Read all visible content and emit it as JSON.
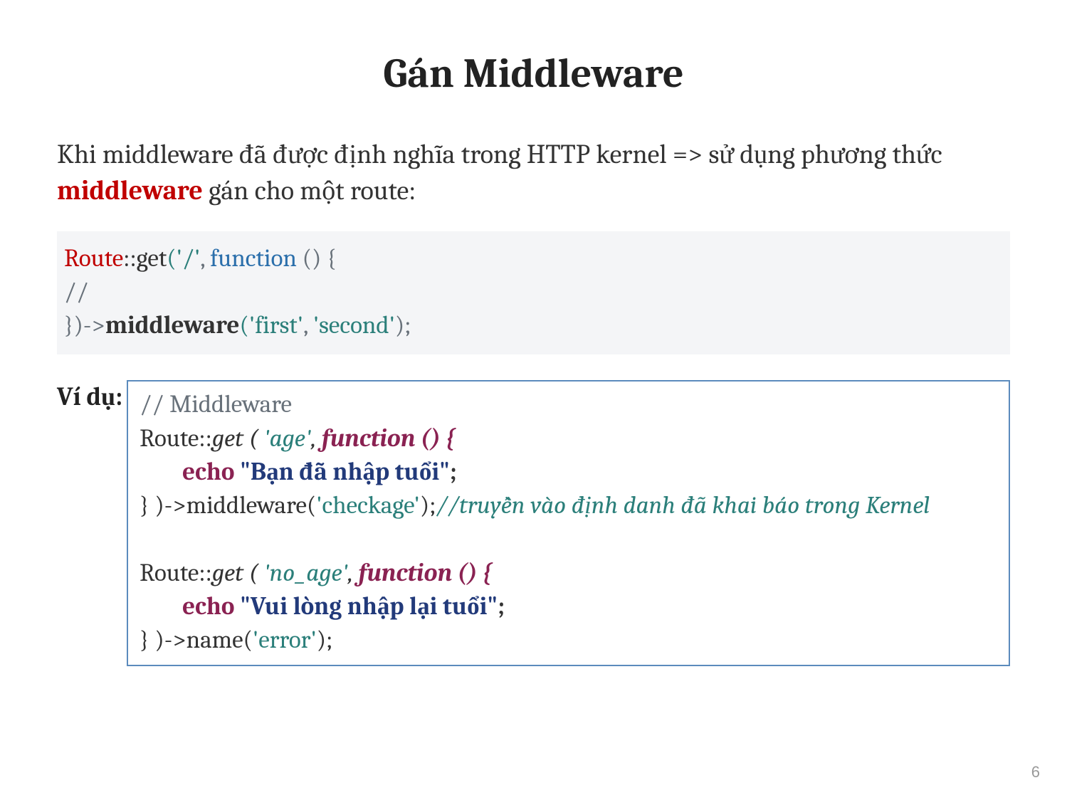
{
  "title": "Gán Middleware",
  "paragraph": {
    "p1": "Khi middleware đã được định nghĩa trong HTTP kernel => sử dụng phương thức ",
    "kw": "middleware",
    "p2": " gán cho một route:"
  },
  "code1": {
    "l1_route": "Route",
    "l1_get": "::get",
    "l1_open": "(",
    "l1_str": "'/'",
    "l1_comma": ", ",
    "l1_func": "function ",
    "l1_rest": "() {",
    "l2": " //",
    "l3_close": "})->",
    "l3_mw": "middleware",
    "l3_open": "(",
    "l3_arg1": "'first'",
    "l3_comma": ", ",
    "l3_arg2": "'second'",
    "l3_end": ");"
  },
  "example_label": "Ví dụ:",
  "ex": {
    "c1": "// Middleware",
    "r1_route": "Route::",
    "r1_get": "get ( ",
    "r1_arg": "'age'",
    "r1_comma": ", ",
    "r1_func": "function () {",
    "r1_echo": "echo ",
    "r1_str": "\"Bạn đã nhập tuổi\"",
    "r1_semi": ";",
    "r1_close": "} )->middleware(",
    "r1_check": "'checkage'",
    "r1_end": ");",
    "r1_comment": "//truyền vào định danh đã khai báo trong Kernel",
    "r2_route": "Route::",
    "r2_get": "get ( ",
    "r2_arg": "'no_age'",
    "r2_comma": ", ",
    "r2_func": "function () {",
    "r2_echo": "echo ",
    "r2_str": "\"Vui lòng nhập lại tuổi\"",
    "r2_semi": ";",
    "r2_close": "} )->name(",
    "r2_err": "'error'",
    "r2_end": ");"
  },
  "page_number": "6"
}
